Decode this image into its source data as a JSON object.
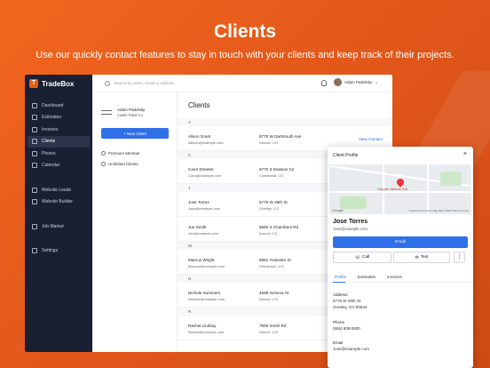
{
  "headline": "Clients",
  "subline": "Use our quickly contact features to stay in touch with  your clients and keep track of their projects.",
  "app": {
    "brand": "TradeBox",
    "nav": [
      "Dashboard",
      "Estimates",
      "Invoices",
      "Clients",
      "Photos",
      "Calendar"
    ],
    "nav2": [
      "Website Leads",
      "Website Builder"
    ],
    "nav3": [
      "Job Market"
    ],
    "nav4": [
      "Settings"
    ],
    "search_placeholder": "Search by name, email or address",
    "user_name": "Adam Padolsky",
    "company_owner": "Adam Padolsky",
    "company_name": "Austin Paint Co",
    "new_client": "+ New Client",
    "premium": "Premium Member",
    "unlimited": "Unlimited Clients",
    "clients_title": "Clients",
    "view_contact": "View Contact",
    "groups": [
      {
        "letter": "A",
        "rows": [
          {
            "name": "Alison Grant",
            "email": "Allison@example.com",
            "addr": "5775 W Dartmouth Ave",
            "city": "Denver ,CO"
          }
        ]
      },
      {
        "letter": "C",
        "rows": [
          {
            "name": "Carol Streeter",
            "email": "Carol@example.com",
            "addr": "6770 S Dawson Cir",
            "city": "Centennial ,CO"
          }
        ]
      },
      {
        "letter": "J",
        "rows": [
          {
            "name": "Jose Torres",
            "email": "Jose@example.com",
            "addr": "5775 W 29th St",
            "city": "Greeley ,CO"
          },
          {
            "name": "Joe Smith",
            "email": "Joe@example.com",
            "addr": "5650 S Chambers Rd",
            "city": "Aurora ,CO"
          }
        ]
      },
      {
        "letter": "M",
        "rows": [
          {
            "name": "Marcus Wright",
            "email": "Marcus@example.com",
            "addr": "8951 Yosemite St",
            "city": "Henderson ,CO"
          }
        ]
      },
      {
        "letter": "N",
        "rows": [
          {
            "name": "Nichole Summers",
            "email": "Nichole@example.com",
            "addr": "4695 Geneva St",
            "city": "Denver ,CO"
          }
        ]
      },
      {
        "letter": "R",
        "rows": [
          {
            "name": "Rachel Lindsay",
            "email": "Rachel@example.com",
            "addr": "7600 Smith Rd",
            "city": "Denver ,CO"
          }
        ]
      }
    ]
  },
  "profile": {
    "title": "Client Profile",
    "close": "×",
    "map_google": "Google",
    "map_attr": "Keyboard shortcuts   Map data ©2022   Terms of Use",
    "map_place": "Chipotle Mexican Grill",
    "name": "Jose Torres",
    "email": "Jose@example.com",
    "email_btn": "Email",
    "call_btn": "Call",
    "text_btn": "Text",
    "more": "⋮",
    "tabs": [
      "Profile",
      "Estimates",
      "Invoices"
    ],
    "address_label": "Address",
    "address_line1": "5775 W 29th St",
    "address_line2": "Greeley, CO 80634",
    "phone_label": "Phone",
    "phone": "(555) 808-0800",
    "email_label": "Email",
    "email_val": "Jose@example.com"
  }
}
